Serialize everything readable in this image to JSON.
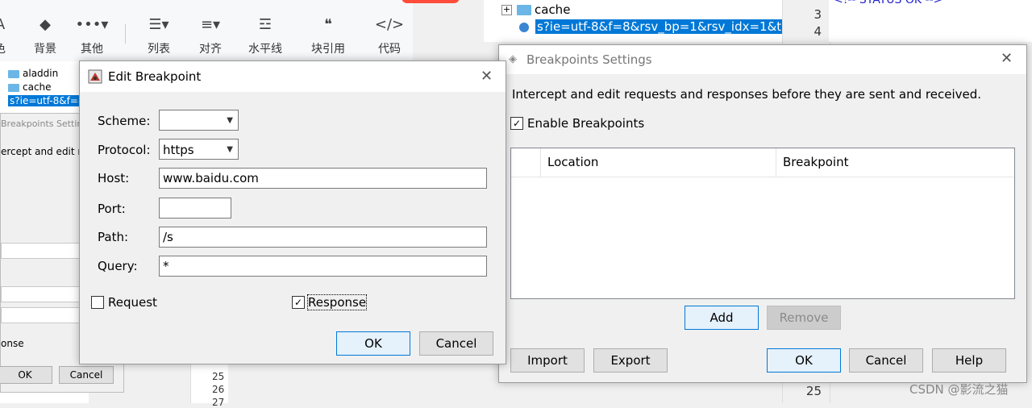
{
  "toolbar": {
    "items": [
      {
        "label": "色",
        "icon": "A"
      },
      {
        "label": "背景",
        "icon": "◆"
      },
      {
        "label": "其他",
        "icon": "•••▾"
      },
      {
        "label": "列表",
        "icon": "☰▾"
      },
      {
        "label": "对齐",
        "icon": "≡▾"
      },
      {
        "label": "水平线",
        "icon": "☲"
      },
      {
        "label": "块引用",
        "icon": "❝"
      },
      {
        "label": "代码",
        "icon": "</>"
      }
    ]
  },
  "left_tree": {
    "items": [
      {
        "label": "aladdin"
      },
      {
        "label": "cache"
      },
      {
        "label": "s?ie=utf-8&f=8&"
      }
    ]
  },
  "ghost_dialog": {
    "title": "Breakpoints Settin",
    "desc": "ercept and edit re",
    "response_label": "onse",
    "ok": "OK",
    "cancel": "Cancel"
  },
  "mid_lines": [
    "25",
    "26",
    "27"
  ],
  "right_tree": {
    "items": [
      {
        "label": "cache"
      },
      {
        "label": "s?ie=utf-8&f=8&rsv_bp=1&rsv_idx=1&t"
      }
    ]
  },
  "line_numbers": [
    "3",
    "4",
    "25"
  ],
  "code_snippet": "<!-- STATUS OK -->",
  "breakpoints_settings": {
    "title": "Breakpoints Settings",
    "description": "Intercept and edit requests and responses before they are sent and received.",
    "enable_label": "Enable Breakpoints",
    "enable_checked": true,
    "columns": [
      "Location",
      "Breakpoint"
    ],
    "add": "Add",
    "remove": "Remove",
    "import": "Import",
    "export": "Export",
    "ok": "OK",
    "cancel": "Cancel",
    "help": "Help"
  },
  "edit_breakpoint": {
    "title": "Edit Breakpoint",
    "scheme_label": "Scheme:",
    "scheme_value": "",
    "protocol_label": "Protocol:",
    "protocol_value": "https",
    "host_label": "Host:",
    "host_value": "www.baidu.com",
    "port_label": "Port:",
    "port_value": "",
    "path_label": "Path:",
    "path_value": "/s",
    "query_label": "Query:",
    "query_value": "*",
    "request_label": "Request",
    "request_checked": false,
    "response_label": "Response",
    "response_checked": true,
    "ok": "OK",
    "cancel": "Cancel"
  },
  "watermark": "CSDN @影流之猫"
}
